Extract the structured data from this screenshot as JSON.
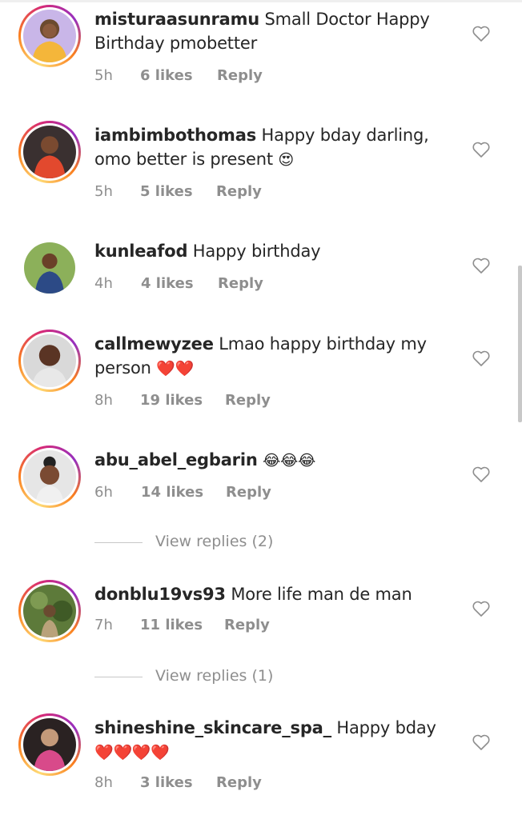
{
  "comments": [
    {
      "username": "misturaasunramu",
      "text": "Small Doctor Happy Birthday pmobetter",
      "emoji": "",
      "time": "5h",
      "likes": "6 likes",
      "reply": "Reply",
      "ring": true
    },
    {
      "username": "iambimbothomas",
      "text": "Happy bday darling, omo better is present",
      "emoji": "😍",
      "time": "5h",
      "likes": "5 likes",
      "reply": "Reply",
      "ring": true
    },
    {
      "username": "kunleafod",
      "text": "Happy birthday",
      "emoji": "",
      "time": "4h",
      "likes": "4 likes",
      "reply": "Reply",
      "ring": false
    },
    {
      "username": "callmewyzee",
      "text": "Lmao happy birthday my person",
      "emoji": "❤️❤️",
      "time": "8h",
      "likes": "19 likes",
      "reply": "Reply",
      "ring": true
    },
    {
      "username": "abu_abel_egbarin",
      "text": "",
      "emoji": "😂😂😂",
      "time": "6h",
      "likes": "14 likes",
      "reply": "Reply",
      "ring": true
    },
    {
      "username": "donblu19vs93",
      "text": "More life man de man",
      "emoji": "",
      "time": "7h",
      "likes": "11 likes",
      "reply": "Reply",
      "ring": true
    },
    {
      "username": "shineshine_skincare_spa_",
      "text": "Happy bday",
      "emoji": "❤️❤️❤️❤️",
      "time": "8h",
      "likes": "3 likes",
      "reply": "Reply",
      "ring": true
    }
  ],
  "view_replies": [
    {
      "label": "View replies (2)"
    },
    {
      "label": "View replies (1)"
    }
  ],
  "icons": {
    "heart": "heart-outline-icon"
  },
  "colors": {
    "text": "#262626",
    "meta": "#8e8e8e",
    "heart_emoji": "#e0242e"
  }
}
